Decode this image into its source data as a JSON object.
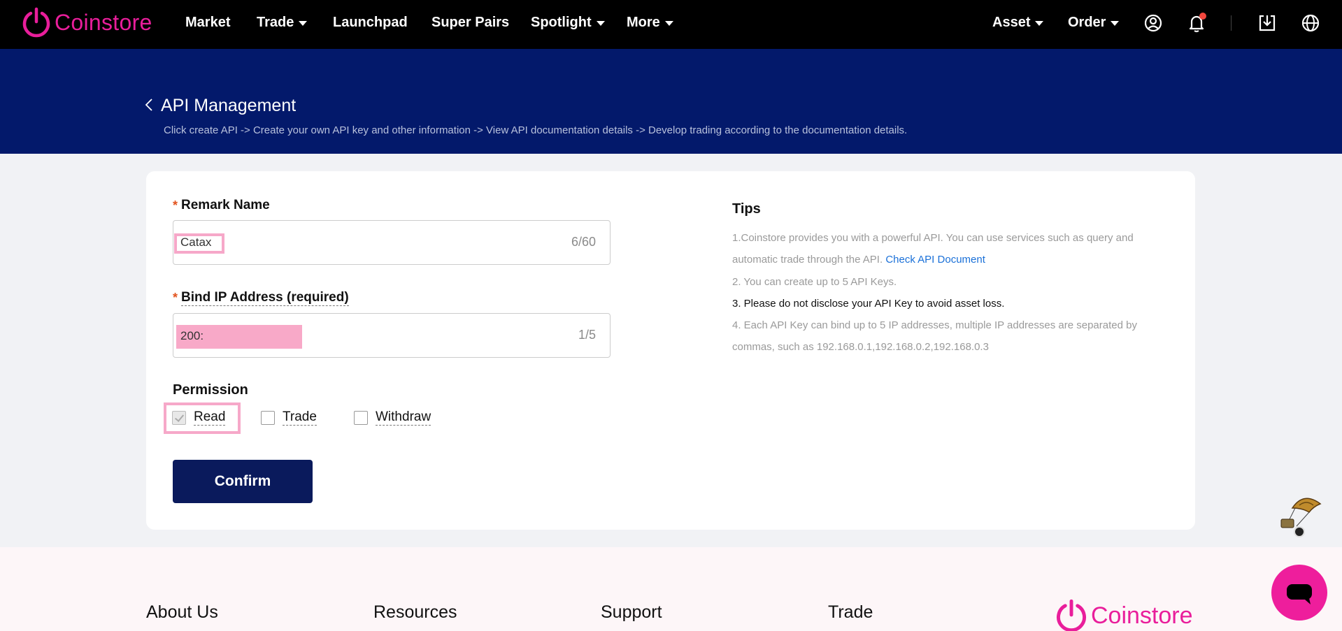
{
  "nav": {
    "logo_text": "Coinstore",
    "items": [
      {
        "label": "Market",
        "dropdown": false
      },
      {
        "label": "Trade",
        "dropdown": true
      },
      {
        "label": "Launchpad",
        "dropdown": false
      },
      {
        "label": "Super Pairs",
        "dropdown": false
      },
      {
        "label": "Spotlight",
        "dropdown": true
      },
      {
        "label": "More",
        "dropdown": true
      }
    ],
    "asset_label": "Asset",
    "order_label": "Order",
    "icons": [
      "user-icon",
      "bell-icon",
      "download-icon",
      "globe-icon"
    ]
  },
  "header": {
    "title": "API Management",
    "subtitle": "Click create API -> Create your own API key and other information -> View API documentation details -> Develop trading according to the documentation details."
  },
  "form": {
    "remark": {
      "label": "Remark Name",
      "required_mark": "*",
      "value": "Catax",
      "counter": "6/60"
    },
    "ip": {
      "label": "Bind IP Address (required)",
      "required_mark": "*",
      "value": "200:",
      "counter": "1/5"
    },
    "permission": {
      "title": "Permission",
      "options": [
        {
          "label": "Read",
          "checked": true
        },
        {
          "label": "Trade",
          "checked": false
        },
        {
          "label": "Withdraw",
          "checked": false
        }
      ]
    },
    "confirm_label": "Confirm"
  },
  "tips": {
    "title": "Tips",
    "tip1": "1.Coinstore provides you with a powerful API. You can use services such as query and automatic trade through the API.",
    "tip1_link": "Check API Document",
    "tip2": "2. You can create up to 5 API Keys.",
    "tip3": "3. Please do not disclose your API Key to avoid asset loss.",
    "tip4": "4. Each API Key can bind up to 5 IP addresses, multiple IP addresses are separated by commas, such as 192.168.0.1,192.168.0.2,192.168.0.3"
  },
  "footer": {
    "columns": [
      "About Us",
      "Resources",
      "Support",
      "Trade"
    ],
    "logo_text": "Coinstore"
  },
  "colors": {
    "brand_pink": "#e91e9b",
    "banner_blue": "#03196b",
    "confirm_navy": "#0a1a5c",
    "highlight_pink": "#f6a8c9"
  }
}
